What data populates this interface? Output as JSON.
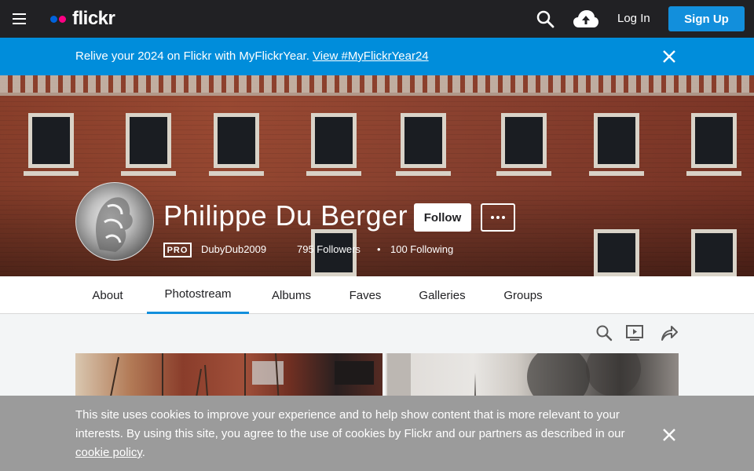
{
  "topbar": {
    "logo_text": "flickr",
    "login_label": "Log In",
    "signup_label": "Sign Up"
  },
  "promo": {
    "text": "Relive your 2024 on Flickr with MyFlickrYear.",
    "link": "View #MyFlickrYear24"
  },
  "profile": {
    "name": "Philippe Du Berger",
    "follow_label": "Follow",
    "pro_label": "PRO",
    "username": "DubyDub2009",
    "followers": "795 Followers",
    "separator": "•",
    "following": "100 Following"
  },
  "tabs": [
    {
      "label": "About"
    },
    {
      "label": "Photostream"
    },
    {
      "label": "Albums"
    },
    {
      "label": "Faves"
    },
    {
      "label": "Galleries"
    },
    {
      "label": "Groups"
    }
  ],
  "active_tab": "Photostream",
  "cookie": {
    "text": "This site uses cookies to improve your experience and to help show content that is more relevant to your interests. By using this site, you agree to the use of cookies by Flickr and our partners as described in our",
    "link": "cookie policy",
    "suffix": "."
  },
  "colors": {
    "topbar": "#212124",
    "promo": "#008ddb",
    "accent": "#128fdc",
    "cookie_bg": "#9b9b9b"
  },
  "icons": [
    "menu-icon",
    "search-icon",
    "cloud-upload-icon",
    "close-icon",
    "more-icon",
    "slideshow-icon",
    "share-icon"
  ]
}
